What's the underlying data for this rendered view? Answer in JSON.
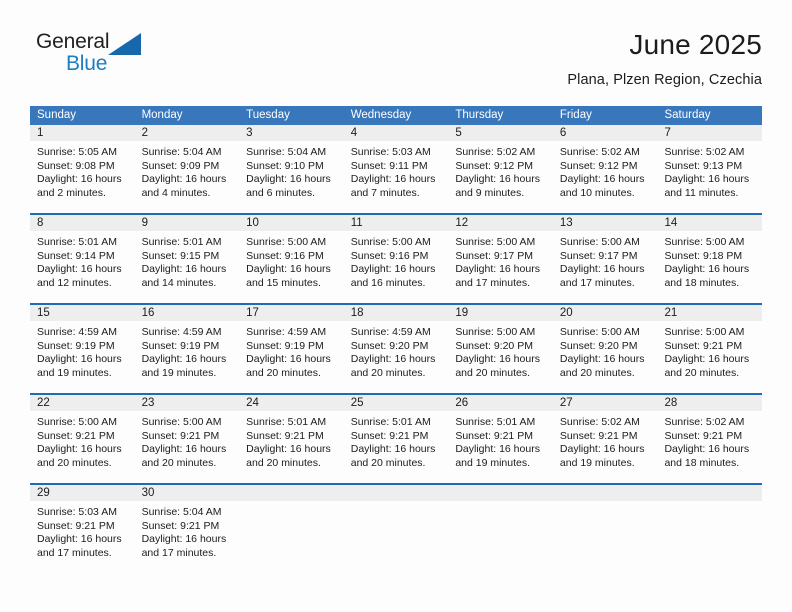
{
  "brand": {
    "name_part1": "General",
    "name_part2": "Blue",
    "triangle_color": "#1767ad",
    "blue_color": "#1f7dc0"
  },
  "header": {
    "title": "June 2025",
    "subtitle": "Plana, Plzen Region, Czechia"
  },
  "theme": {
    "header_blue": "#3877bc",
    "row_border_blue": "#1f6cb5",
    "day_band_gray": "#eeeeee",
    "text_color": "#1c1c1c"
  },
  "weekdays": [
    "Sunday",
    "Monday",
    "Tuesday",
    "Wednesday",
    "Thursday",
    "Friday",
    "Saturday"
  ],
  "weeks": [
    [
      {
        "day": "1",
        "sunrise": "Sunrise: 5:05 AM",
        "sunset": "Sunset: 9:08 PM",
        "daylight1": "Daylight: 16 hours",
        "daylight2": "and 2 minutes."
      },
      {
        "day": "2",
        "sunrise": "Sunrise: 5:04 AM",
        "sunset": "Sunset: 9:09 PM",
        "daylight1": "Daylight: 16 hours",
        "daylight2": "and 4 minutes."
      },
      {
        "day": "3",
        "sunrise": "Sunrise: 5:04 AM",
        "sunset": "Sunset: 9:10 PM",
        "daylight1": "Daylight: 16 hours",
        "daylight2": "and 6 minutes."
      },
      {
        "day": "4",
        "sunrise": "Sunrise: 5:03 AM",
        "sunset": "Sunset: 9:11 PM",
        "daylight1": "Daylight: 16 hours",
        "daylight2": "and 7 minutes."
      },
      {
        "day": "5",
        "sunrise": "Sunrise: 5:02 AM",
        "sunset": "Sunset: 9:12 PM",
        "daylight1": "Daylight: 16 hours",
        "daylight2": "and 9 minutes."
      },
      {
        "day": "6",
        "sunrise": "Sunrise: 5:02 AM",
        "sunset": "Sunset: 9:12 PM",
        "daylight1": "Daylight: 16 hours",
        "daylight2": "and 10 minutes."
      },
      {
        "day": "7",
        "sunrise": "Sunrise: 5:02 AM",
        "sunset": "Sunset: 9:13 PM",
        "daylight1": "Daylight: 16 hours",
        "daylight2": "and 11 minutes."
      }
    ],
    [
      {
        "day": "8",
        "sunrise": "Sunrise: 5:01 AM",
        "sunset": "Sunset: 9:14 PM",
        "daylight1": "Daylight: 16 hours",
        "daylight2": "and 12 minutes."
      },
      {
        "day": "9",
        "sunrise": "Sunrise: 5:01 AM",
        "sunset": "Sunset: 9:15 PM",
        "daylight1": "Daylight: 16 hours",
        "daylight2": "and 14 minutes."
      },
      {
        "day": "10",
        "sunrise": "Sunrise: 5:00 AM",
        "sunset": "Sunset: 9:16 PM",
        "daylight1": "Daylight: 16 hours",
        "daylight2": "and 15 minutes."
      },
      {
        "day": "11",
        "sunrise": "Sunrise: 5:00 AM",
        "sunset": "Sunset: 9:16 PM",
        "daylight1": "Daylight: 16 hours",
        "daylight2": "and 16 minutes."
      },
      {
        "day": "12",
        "sunrise": "Sunrise: 5:00 AM",
        "sunset": "Sunset: 9:17 PM",
        "daylight1": "Daylight: 16 hours",
        "daylight2": "and 17 minutes."
      },
      {
        "day": "13",
        "sunrise": "Sunrise: 5:00 AM",
        "sunset": "Sunset: 9:17 PM",
        "daylight1": "Daylight: 16 hours",
        "daylight2": "and 17 minutes."
      },
      {
        "day": "14",
        "sunrise": "Sunrise: 5:00 AM",
        "sunset": "Sunset: 9:18 PM",
        "daylight1": "Daylight: 16 hours",
        "daylight2": "and 18 minutes."
      }
    ],
    [
      {
        "day": "15",
        "sunrise": "Sunrise: 4:59 AM",
        "sunset": "Sunset: 9:19 PM",
        "daylight1": "Daylight: 16 hours",
        "daylight2": "and 19 minutes."
      },
      {
        "day": "16",
        "sunrise": "Sunrise: 4:59 AM",
        "sunset": "Sunset: 9:19 PM",
        "daylight1": "Daylight: 16 hours",
        "daylight2": "and 19 minutes."
      },
      {
        "day": "17",
        "sunrise": "Sunrise: 4:59 AM",
        "sunset": "Sunset: 9:19 PM",
        "daylight1": "Daylight: 16 hours",
        "daylight2": "and 20 minutes."
      },
      {
        "day": "18",
        "sunrise": "Sunrise: 4:59 AM",
        "sunset": "Sunset: 9:20 PM",
        "daylight1": "Daylight: 16 hours",
        "daylight2": "and 20 minutes."
      },
      {
        "day": "19",
        "sunrise": "Sunrise: 5:00 AM",
        "sunset": "Sunset: 9:20 PM",
        "daylight1": "Daylight: 16 hours",
        "daylight2": "and 20 minutes."
      },
      {
        "day": "20",
        "sunrise": "Sunrise: 5:00 AM",
        "sunset": "Sunset: 9:20 PM",
        "daylight1": "Daylight: 16 hours",
        "daylight2": "and 20 minutes."
      },
      {
        "day": "21",
        "sunrise": "Sunrise: 5:00 AM",
        "sunset": "Sunset: 9:21 PM",
        "daylight1": "Daylight: 16 hours",
        "daylight2": "and 20 minutes."
      }
    ],
    [
      {
        "day": "22",
        "sunrise": "Sunrise: 5:00 AM",
        "sunset": "Sunset: 9:21 PM",
        "daylight1": "Daylight: 16 hours",
        "daylight2": "and 20 minutes."
      },
      {
        "day": "23",
        "sunrise": "Sunrise: 5:00 AM",
        "sunset": "Sunset: 9:21 PM",
        "daylight1": "Daylight: 16 hours",
        "daylight2": "and 20 minutes."
      },
      {
        "day": "24",
        "sunrise": "Sunrise: 5:01 AM",
        "sunset": "Sunset: 9:21 PM",
        "daylight1": "Daylight: 16 hours",
        "daylight2": "and 20 minutes."
      },
      {
        "day": "25",
        "sunrise": "Sunrise: 5:01 AM",
        "sunset": "Sunset: 9:21 PM",
        "daylight1": "Daylight: 16 hours",
        "daylight2": "and 20 minutes."
      },
      {
        "day": "26",
        "sunrise": "Sunrise: 5:01 AM",
        "sunset": "Sunset: 9:21 PM",
        "daylight1": "Daylight: 16 hours",
        "daylight2": "and 19 minutes."
      },
      {
        "day": "27",
        "sunrise": "Sunrise: 5:02 AM",
        "sunset": "Sunset: 9:21 PM",
        "daylight1": "Daylight: 16 hours",
        "daylight2": "and 19 minutes."
      },
      {
        "day": "28",
        "sunrise": "Sunrise: 5:02 AM",
        "sunset": "Sunset: 9:21 PM",
        "daylight1": "Daylight: 16 hours",
        "daylight2": "and 18 minutes."
      }
    ],
    [
      {
        "day": "29",
        "sunrise": "Sunrise: 5:03 AM",
        "sunset": "Sunset: 9:21 PM",
        "daylight1": "Daylight: 16 hours",
        "daylight2": "and 17 minutes."
      },
      {
        "day": "30",
        "sunrise": "Sunrise: 5:04 AM",
        "sunset": "Sunset: 9:21 PM",
        "daylight1": "Daylight: 16 hours",
        "daylight2": "and 17 minutes."
      },
      {
        "day": "",
        "sunrise": "",
        "sunset": "",
        "daylight1": "",
        "daylight2": ""
      },
      {
        "day": "",
        "sunrise": "",
        "sunset": "",
        "daylight1": "",
        "daylight2": ""
      },
      {
        "day": "",
        "sunrise": "",
        "sunset": "",
        "daylight1": "",
        "daylight2": ""
      },
      {
        "day": "",
        "sunrise": "",
        "sunset": "",
        "daylight1": "",
        "daylight2": ""
      },
      {
        "day": "",
        "sunrise": "",
        "sunset": "",
        "daylight1": "",
        "daylight2": ""
      }
    ]
  ]
}
